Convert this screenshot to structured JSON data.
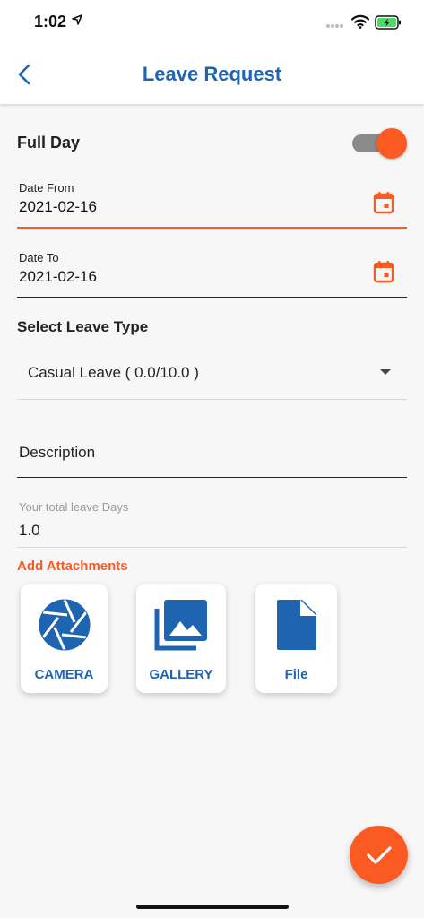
{
  "status_bar": {
    "time": "1:02"
  },
  "header": {
    "title": "Leave Request"
  },
  "form": {
    "full_day_label": "Full Day",
    "full_day_on": true,
    "date_from_label": "Date From",
    "date_from_value": "2021-02-16",
    "date_to_label": "Date To",
    "date_to_value": "2021-02-16",
    "leave_type_label": "Select Leave Type",
    "leave_type_value": "Casual Leave ( 0.0/10.0 )",
    "description_placeholder": "Description",
    "total_days_label": "Your total leave Days",
    "total_days_value": "1.0"
  },
  "attachments": {
    "title": "Add Attachments",
    "options": [
      {
        "label": "CAMERA",
        "icon": "camera-aperture-icon"
      },
      {
        "label": "GALLERY",
        "icon": "gallery-icon"
      },
      {
        "label": "File",
        "icon": "file-icon"
      }
    ]
  },
  "colors": {
    "accent": "#fc5a23",
    "primary": "#1f64b0",
    "background": "#f7f7f7"
  }
}
